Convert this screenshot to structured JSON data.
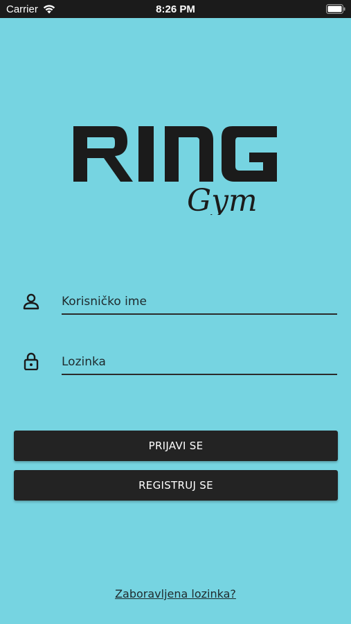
{
  "status_bar": {
    "carrier": "Carrier",
    "time": "8:26 PM"
  },
  "logo": {
    "brand": "RING",
    "sub": "Gym"
  },
  "form": {
    "username_placeholder": "Korisničko ime",
    "password_placeholder": "Lozinka"
  },
  "buttons": {
    "login": "PRIJAVI SE",
    "register": "REGISTRUJ SE"
  },
  "forgot_password": "Zaboravljena lozinka?",
  "colors": {
    "background": "#76d4e1",
    "button": "#232323",
    "status_bar": "#1b1b1b"
  },
  "icons": {
    "username": "person-icon",
    "password": "lock-icon"
  }
}
